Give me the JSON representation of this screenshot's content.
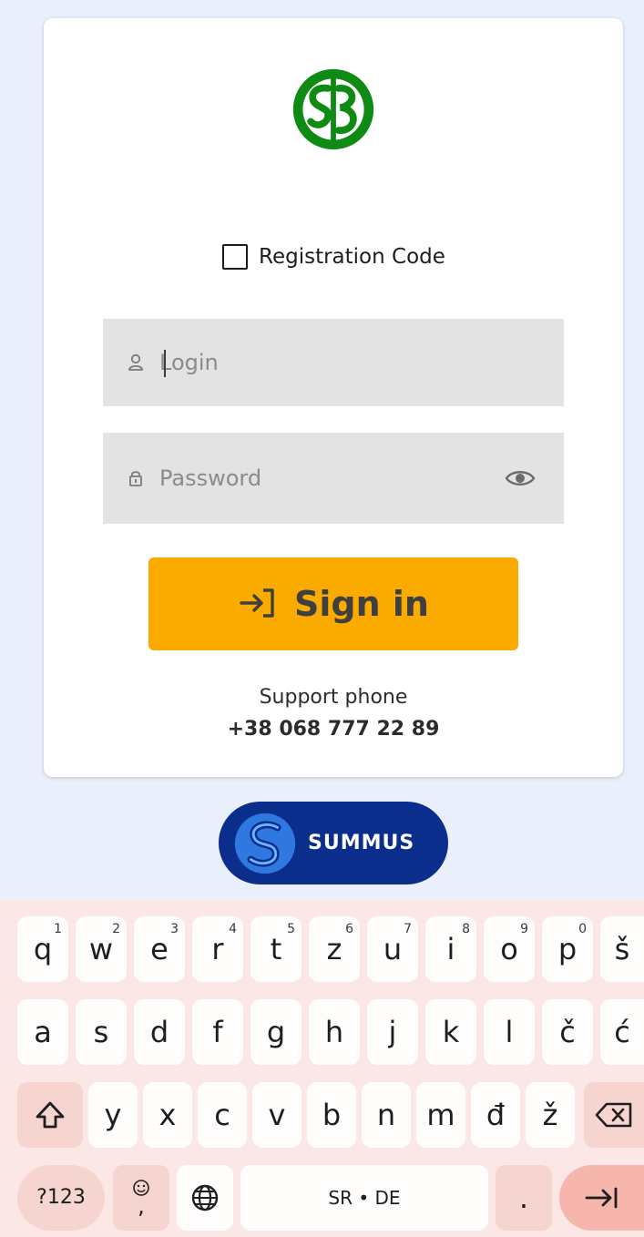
{
  "registration": {
    "checkbox_label": "Registration Code",
    "checked": false
  },
  "login": {
    "placeholder": "Login",
    "value": ""
  },
  "password": {
    "placeholder": "Password",
    "value": ""
  },
  "signin": {
    "label": "Sign in"
  },
  "support": {
    "label": "Support phone",
    "phone": "+38 068 777 22 89"
  },
  "partner": {
    "logo_text": "SUMMUS"
  },
  "icons": {
    "brand": "sb-monogram-logo",
    "user": "user-icon",
    "lock": "lock-icon",
    "eye": "eye-icon",
    "signin": "sign-in-arrow-icon"
  },
  "colors": {
    "brand_green": "#0f8a12",
    "signin_bg": "#fbab00",
    "field_bg": "#e3e3e3",
    "page_bg": "#e9effb",
    "summus_blue": "#0b2d8c",
    "keyboard_bg": "#fbe8e6"
  },
  "keyboard": {
    "row1": [
      {
        "key": "q",
        "hint": "1"
      },
      {
        "key": "w",
        "hint": "2"
      },
      {
        "key": "e",
        "hint": "3"
      },
      {
        "key": "r",
        "hint": "4"
      },
      {
        "key": "t",
        "hint": "5"
      },
      {
        "key": "z",
        "hint": "6"
      },
      {
        "key": "u",
        "hint": "7"
      },
      {
        "key": "i",
        "hint": "8"
      },
      {
        "key": "o",
        "hint": "9"
      },
      {
        "key": "p",
        "hint": "0"
      },
      {
        "key": "š",
        "hint": ""
      }
    ],
    "row2": [
      "a",
      "s",
      "d",
      "f",
      "g",
      "h",
      "j",
      "k",
      "l",
      "č",
      "ć"
    ],
    "row3": [
      "y",
      "x",
      "c",
      "v",
      "b",
      "n",
      "m",
      "đ",
      "ž"
    ],
    "symbols_label": "?123",
    "emoji_comma_label": ",",
    "space_label": "SR • DE",
    "period_label": ".",
    "icons": {
      "shift": "shift-icon",
      "backspace": "backspace-icon",
      "emoji": "emoji-icon",
      "globe": "globe-icon",
      "enter": "next-arrow-icon"
    }
  }
}
